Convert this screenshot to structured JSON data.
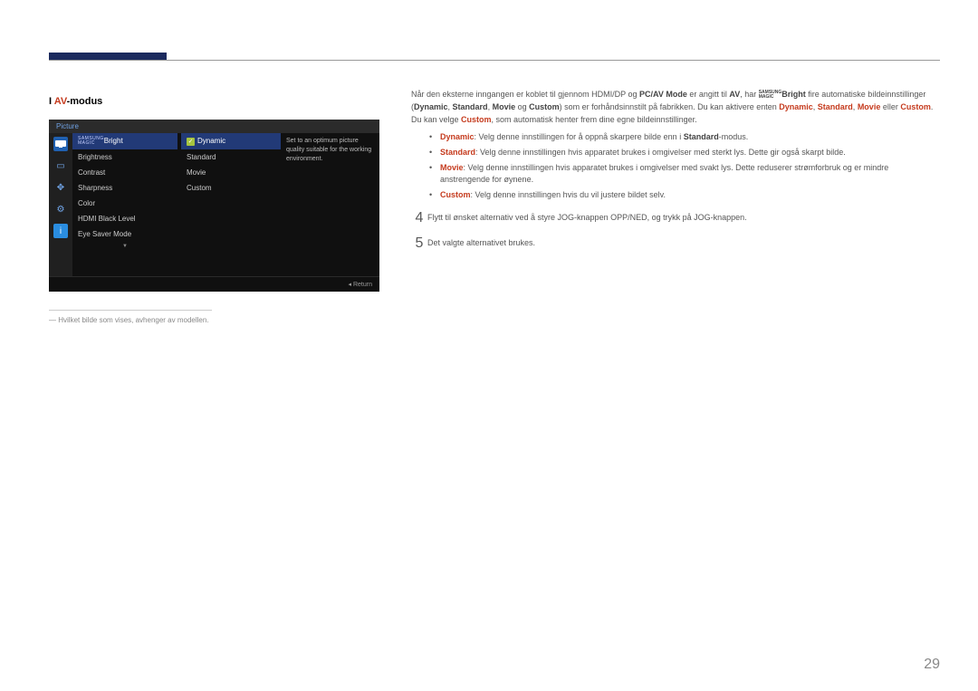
{
  "title_prefix": "I ",
  "title_av": "AV",
  "title_suffix": "-modus",
  "osd": {
    "header": "Picture",
    "left_items": {
      "magic_bright": "Bright",
      "brightness": "Brightness",
      "contrast": "Contrast",
      "sharpness": "Sharpness",
      "color": "Color",
      "hdmi_black": "HDMI Black Level",
      "eye_saver": "Eye Saver Mode"
    },
    "mid_items": {
      "dynamic": "Dynamic",
      "standard": "Standard",
      "movie": "Movie",
      "custom": "Custom"
    },
    "tip": "Set to an optimum picture quality suitable for the working environment.",
    "return": "Return",
    "samsung": "SAMSUNG",
    "magic": "MAGIC"
  },
  "footnote": "Hvilket bilde som vises, avhenger av modellen.",
  "intro": {
    "t1": "Når den eksterne inngangen er koblet til gjennom HDMI/DP og ",
    "pcav": "PC/AV Mode",
    "t2": " er angitt til ",
    "av": "AV",
    "t3": ", har ",
    "bright": "Bright",
    "t4": " fire automatiske bildeinnstillinger (",
    "dynamic": "Dynamic",
    "c1": ", ",
    "standard": "Standard",
    "c2": ", ",
    "movie": "Movie",
    "t5": " og ",
    "custom": "Custom",
    "t6": ") som er forhåndsinnstilt på fabrikken. Du kan aktivere enten ",
    "dynamic2": "Dynamic",
    "c3": ", ",
    "standard2": "Standard",
    "c4": ", ",
    "movie2": "Movie",
    "t7": " eller ",
    "custom2": "Custom",
    "t8": ". Du kan velge ",
    "custom3": "Custom",
    "t9": ", som automatisk henter frem dine egne bildeinnstillinger."
  },
  "opts": {
    "dyn_lbl": "Dynamic",
    "dyn_t1": ": Velg denne innstillingen for å oppnå skarpere bilde enn i ",
    "dyn_std": "Standard",
    "dyn_t2": "-modus.",
    "std_lbl": "Standard",
    "std_txt": ": Velg denne innstillingen hvis apparatet brukes i omgivelser med sterkt lys. Dette gir også skarpt bilde.",
    "mov_lbl": "Movie",
    "mov_txt": ": Velg denne innstillingen hvis apparatet brukes i omgivelser med svakt lys. Dette reduserer strømforbruk og er mindre anstrengende for øynene.",
    "cus_lbl": "Custom",
    "cus_txt": ": Velg denne innstillingen hvis du vil justere bildet selv."
  },
  "step4_num": "4",
  "step4_txt": "Flytt til ønsket alternativ ved å styre JOG-knappen OPP/NED, og trykk på JOG-knappen.",
  "step5_num": "5",
  "step5_txt": "Det valgte alternativet brukes.",
  "page_number": "29"
}
